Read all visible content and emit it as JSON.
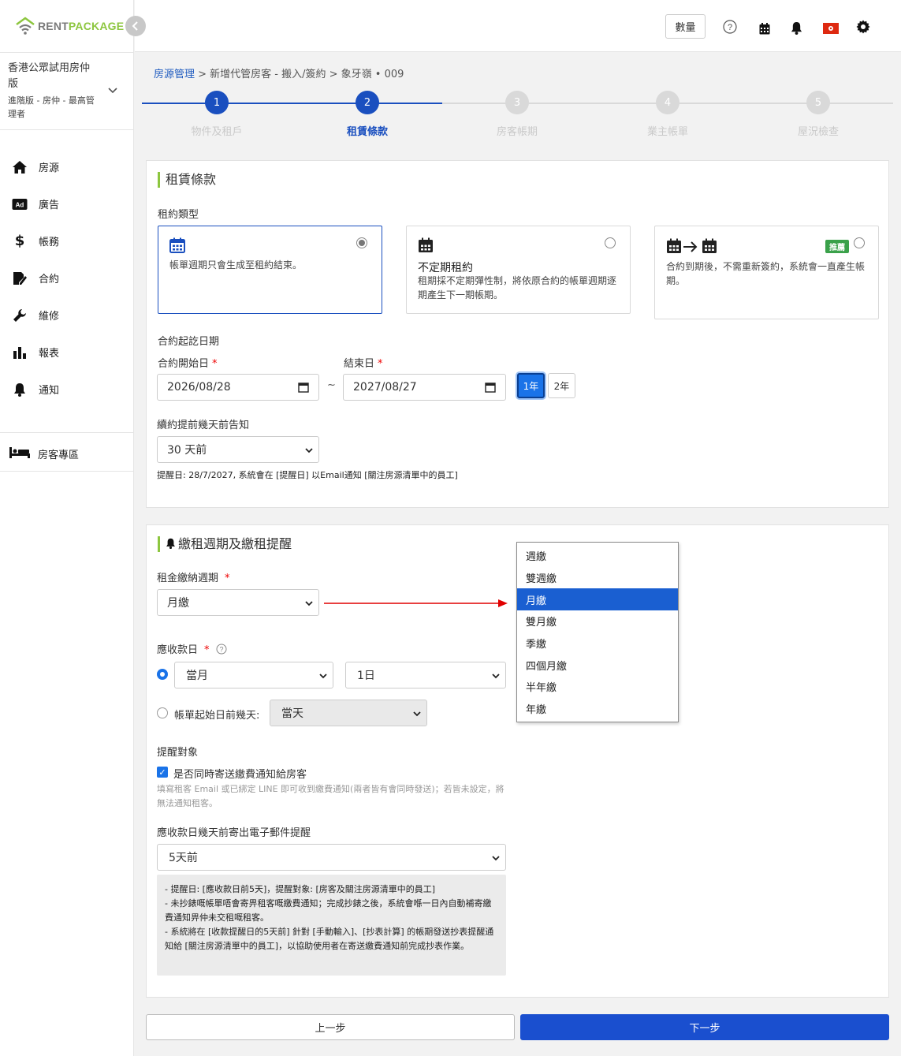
{
  "brand": {
    "part1": "RENT",
    "part2": "PACKAGE",
    "gray": "#7a7a7a",
    "green": "#8dc63f"
  },
  "account": {
    "name": "香港公眾試用房仲版",
    "role": "進階版 - 房仲 - 最高管理者"
  },
  "nav": [
    {
      "label": "房源",
      "icon": "home-icon"
    },
    {
      "label": "廣告",
      "icon": "ad-icon"
    },
    {
      "label": "帳務",
      "icon": "dollar-icon"
    },
    {
      "label": "合約",
      "icon": "contract-icon"
    },
    {
      "label": "維修",
      "icon": "wrench-icon"
    },
    {
      "label": "報表",
      "icon": "bar-chart-icon"
    },
    {
      "label": "通知",
      "icon": "bell-icon"
    }
  ],
  "tenant_zone": {
    "label": "房客專區",
    "icon": "bed-icon"
  },
  "topbar": {
    "qty_label": "數量"
  },
  "breadcrumb": {
    "root": "房源管理",
    "rest": " > 新增代管房客 - 搬入/簽約 > 象牙嶺 • 009"
  },
  "steps": [
    {
      "num": "1",
      "label": "物件及租戶",
      "state": "done"
    },
    {
      "num": "2",
      "label": "租賃條款",
      "state": "active"
    },
    {
      "num": "3",
      "label": "房客帳期",
      "state": "todo"
    },
    {
      "num": "4",
      "label": "業主帳單",
      "state": "todo"
    },
    {
      "num": "5",
      "label": "屋況檢查",
      "state": "todo"
    }
  ],
  "lease": {
    "title": "租賃條款",
    "type_label": "租約類型",
    "options": [
      {
        "title": "",
        "desc": "帳單週期只會生成至租約結束。",
        "selected": true
      },
      {
        "title": "不定期租約",
        "desc": "租期採不定期彈性制，將依原合約的帳單週期逐期產生下一期帳期。",
        "selected": false
      },
      {
        "title": "",
        "desc": "合約到期後，不需重新簽約，系統會一直產生帳期。",
        "badge": "推薦",
        "selected": false
      }
    ],
    "period_label": "合約起訖日期",
    "start_label": "合約開始日",
    "end_label": "結束日",
    "start_value": "2026/08/28",
    "end_value": "2027/08/27",
    "tilde": "~",
    "year1": "1年",
    "year2": "2年",
    "renew_label": "續約提前幾天前告知",
    "renew_value": "30 天前",
    "renew_hint": "提醒日: 28/7/2027, 系統會在 [提醒日] 以Email通知 [關注房源清單中的員工]"
  },
  "rent": {
    "title": "繳租週期及繳租提醒",
    "cycle_label": "租金繳納週期",
    "cycle_value": "月繳",
    "due_label": "應收款日",
    "due_month": "當月",
    "due_day": "1日",
    "before_label": "帳單起始日前幾天:",
    "before_value": "當天",
    "target_label": "提醒對象",
    "notify_label": "是否同時寄送繳費通知給房客",
    "notify_note": "填寫租客 Email 或已綁定 LINE 即可收到繳費通知(兩者皆有會同時發送)；若皆未設定，將無法通知租客。",
    "email_label": "應收款日幾天前寄出電子郵件提醒",
    "email_value": "5天前",
    "notes": [
      "- 提醒日: [應收款日前5天]，提醒對象: [房客及關注房源清單中的員工]",
      "- 未抄錶嘅帳單唔會寄畀租客嘅繳費通知；完成抄錶之後，系統會喺一日內自動補寄繳費通知畀仲未交租嘅租客。",
      "- 系統將在 [收款提醒日的5天前] 針對 [手動輸入]、[抄表計算] 的帳期發送抄表提醒通知給 [關注房源清單中的員工]，以協助使用者在寄送繳費通知前完成抄表作業。"
    ]
  },
  "cycle_options": [
    "週繳",
    "雙週繳",
    "月繳",
    "雙月繳",
    "季繳",
    "四個月繳",
    "半年繳",
    "年繳"
  ],
  "cycle_selected": "月繳",
  "footer": {
    "prev": "上一步",
    "next": "下一步"
  },
  "colors": {
    "primary": "#1a4fbf",
    "accent_green": "#8dc63f",
    "arrow_red": "#e00000"
  }
}
